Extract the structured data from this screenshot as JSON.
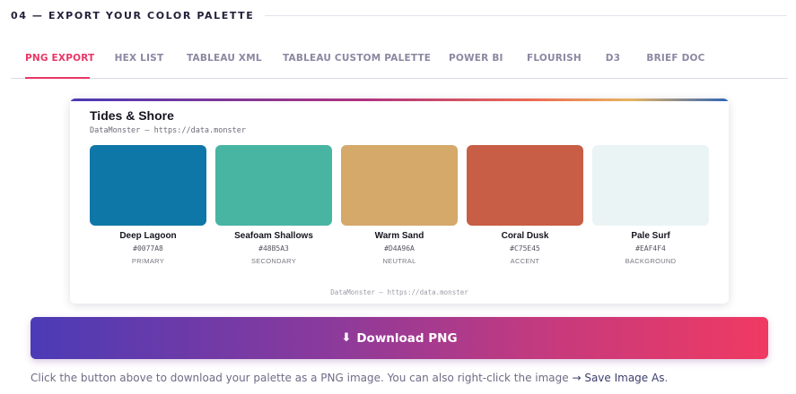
{
  "section": {
    "title": "04 — EXPORT YOUR COLOR PALETTE"
  },
  "tabs": [
    {
      "label": "PNG EXPORT",
      "active": true
    },
    {
      "label": "HEX LIST",
      "active": false
    },
    {
      "label": "TABLEAU XML",
      "active": false
    },
    {
      "label": "TABLEAU CUSTOM PALETTE",
      "active": false
    },
    {
      "label": "POWER BI",
      "active": false
    },
    {
      "label": "FLOURISH",
      "active": false
    },
    {
      "label": "D3",
      "active": false
    },
    {
      "label": "BRIEF DOC",
      "active": false
    }
  ],
  "card": {
    "title": "Tides & Shore",
    "subtitle": "DataMonster — https://data.monster",
    "footer": "DataMonster — https://data.monster",
    "swatches": [
      {
        "name": "Deep Lagoon",
        "hex": "#0077A8",
        "role": "PRIMARY",
        "color": "#0f77a8"
      },
      {
        "name": "Seafoam Shallows",
        "hex": "#48B5A3",
        "role": "SECONDARY",
        "color": "#48b5a3"
      },
      {
        "name": "Warm Sand",
        "hex": "#D4A96A",
        "role": "NEUTRAL",
        "color": "#d4a96a"
      },
      {
        "name": "Coral Dusk",
        "hex": "#C75E45",
        "role": "ACCENT",
        "color": "#c75e45"
      },
      {
        "name": "Pale Surf",
        "hex": "#EAF4F4",
        "role": "BACKGROUND",
        "color": "#eaf4f4"
      }
    ]
  },
  "download": {
    "icon": "download-arrow-icon",
    "label": "Download PNG"
  },
  "help": {
    "text": "Click the button above to download your palette as a PNG image. You can also right-click the image ",
    "emphasis": "→ Save Image As",
    "end": "."
  },
  "colors": {
    "accent": "#e73767",
    "gradient_start": "#4b3bb6",
    "gradient_end": "#f03a62"
  }
}
